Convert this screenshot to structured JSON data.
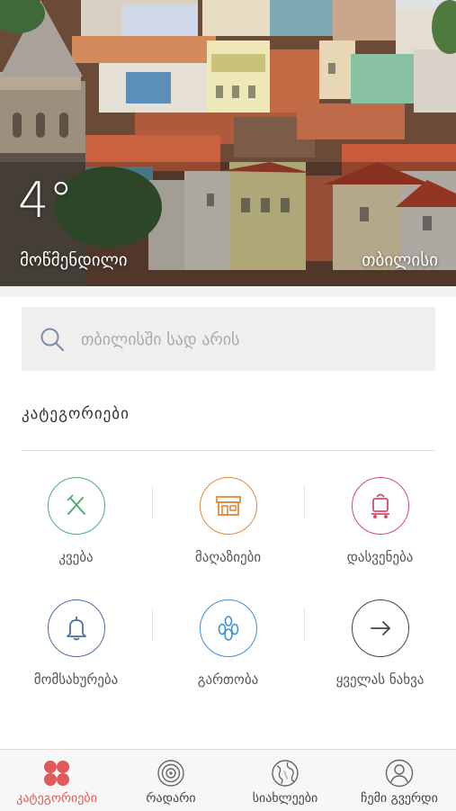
{
  "weather": {
    "temperature": "4°",
    "condition": "მოწმენდილი",
    "city": "თბილისი"
  },
  "search": {
    "placeholder": "თბილისში სად არის",
    "icon": "search-icon"
  },
  "categories_heading": "კატეგორიები",
  "categories": [
    {
      "label": "კვება",
      "icon": "fork-knife-icon",
      "color": "#4caf72"
    },
    {
      "label": "მაღაზიები",
      "icon": "store-icon",
      "color": "#e08a3c"
    },
    {
      "label": "დასვენება",
      "icon": "luggage-cart-icon",
      "color": "#d64b6a"
    },
    {
      "label": "მომსახურება",
      "icon": "bell-icon",
      "color": "#4a6fa5"
    },
    {
      "label": "გართობა",
      "icon": "bowling-icon",
      "color": "#3d8fd6"
    },
    {
      "label": "ყველას ნახვა",
      "icon": "arrow-right-icon",
      "color": "#444444"
    }
  ],
  "tabs": [
    {
      "label": "კატეგორიები",
      "icon": "four-dots-icon",
      "active": true
    },
    {
      "label": "რადარი",
      "icon": "radar-icon",
      "active": false
    },
    {
      "label": "სიახლეები",
      "icon": "globe-icon",
      "active": false
    },
    {
      "label": "ჩემი გვერდი",
      "icon": "user-icon",
      "active": false
    }
  ],
  "colors": {
    "accent": "#e05a5a",
    "search_bg": "#efefef",
    "tabbar_bg": "#f7f7f7"
  }
}
